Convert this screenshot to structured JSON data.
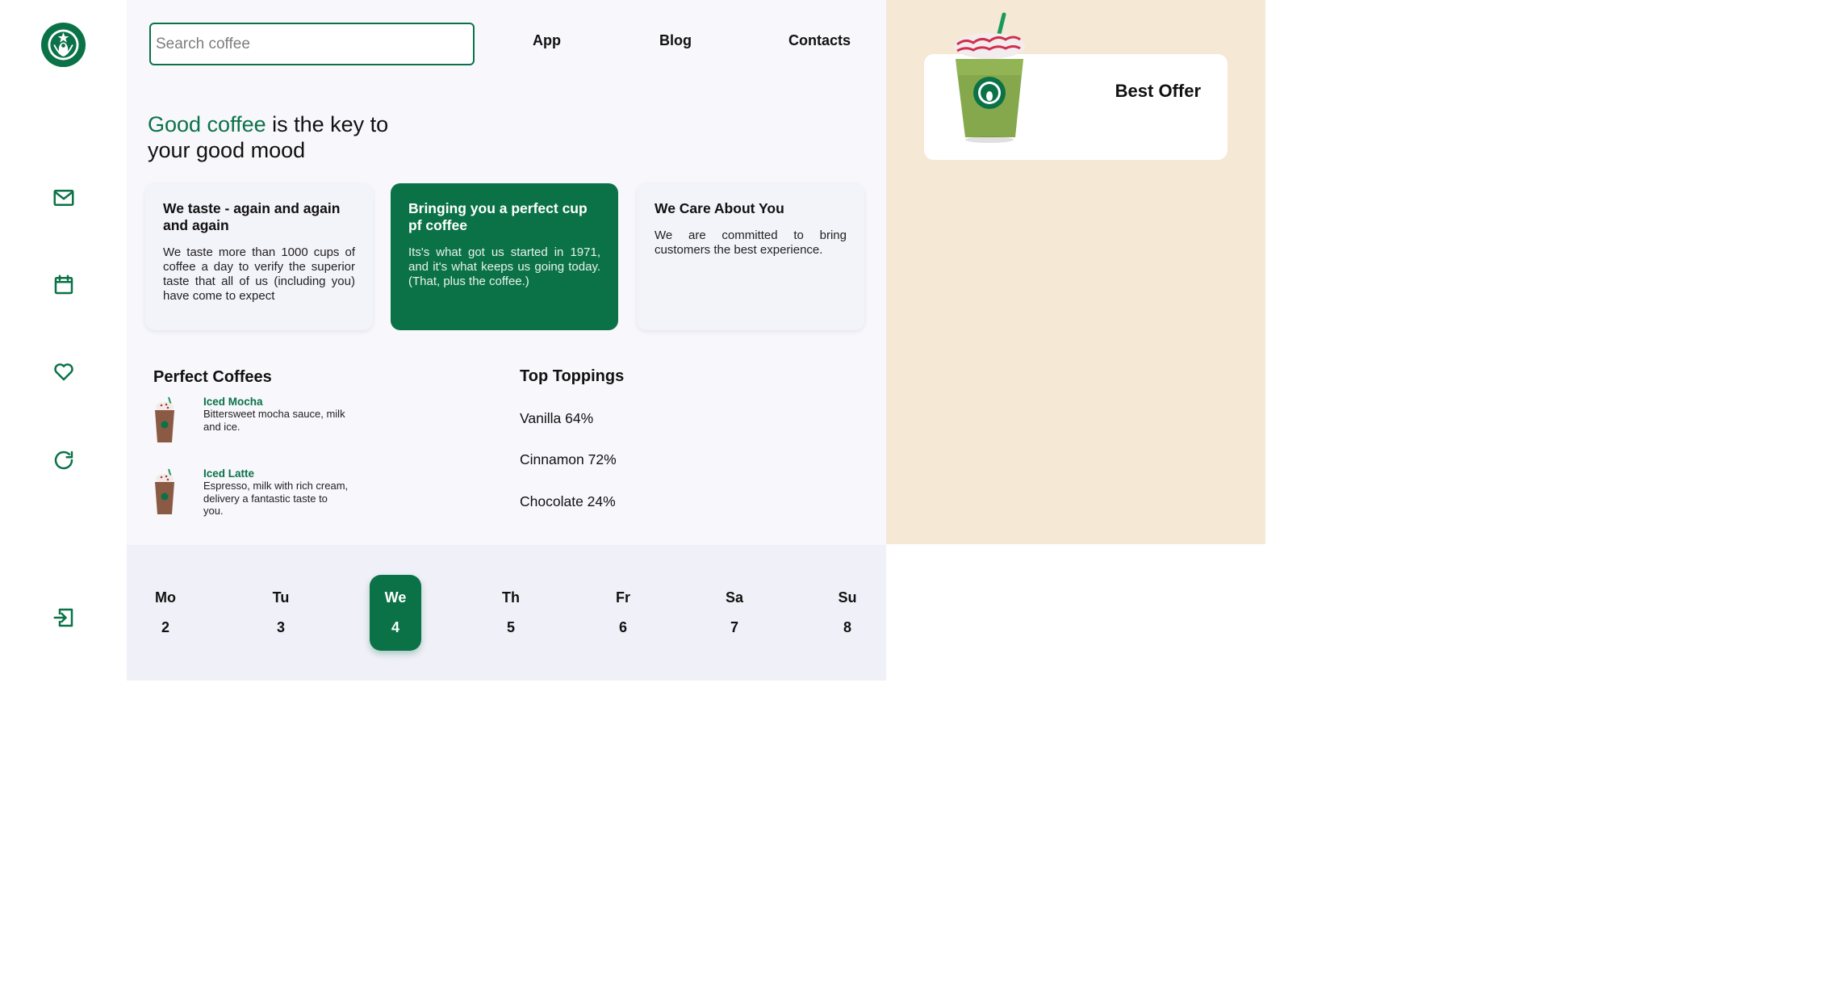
{
  "search": {
    "placeholder": "Search coffee"
  },
  "nav": {
    "app": "App",
    "blog": "Blog",
    "contacts": "Contacts"
  },
  "headline": {
    "accent": "Good coffee",
    "rest_line1": " is the key to",
    "line2": "your good mood"
  },
  "cards": [
    {
      "title": "We taste - again and again and again",
      "text": "We taste more than 1000 cups of coffee a day to verify the superior taste that all of us (including you) have come to expect"
    },
    {
      "title": "Bringing you a perfect cup pf coffee",
      "text": "Its's what got us started in 1971, and it's what keeps us going today. (That, plus the coffee.)"
    },
    {
      "title": "We Care About You",
      "text": "We are committed to bring customers the best experience."
    }
  ],
  "perfect_coffees": {
    "title": "Perfect Coffees",
    "items": [
      {
        "name": "Iced Mocha",
        "desc": "Bittersweet mocha sauce, milk and ice."
      },
      {
        "name": "Iced Latte",
        "desc": "Espresso, milk with rich cream, delivery a fantastic taste to you."
      }
    ]
  },
  "toppings": {
    "title": "Top Toppings",
    "items": [
      "Vanilla 64%",
      "Cinnamon 72%",
      "Chocolate 24%"
    ]
  },
  "week": [
    {
      "name": "Mo",
      "num": "2"
    },
    {
      "name": "Tu",
      "num": "3"
    },
    {
      "name": "We",
      "num": "4",
      "active": true
    },
    {
      "name": "Th",
      "num": "5"
    },
    {
      "name": "Fr",
      "num": "6"
    },
    {
      "name": "Sa",
      "num": "7"
    },
    {
      "name": "Su",
      "num": "8"
    }
  ],
  "offer": {
    "title": "Best Offer"
  },
  "sidebar_icons": [
    "mail-icon",
    "calendar-icon",
    "heart-icon",
    "refresh-icon",
    "logout-icon"
  ],
  "colors": {
    "brand": "#0b7247",
    "panel": "#f5e8d5",
    "main_bg": "#f7f7fc"
  }
}
